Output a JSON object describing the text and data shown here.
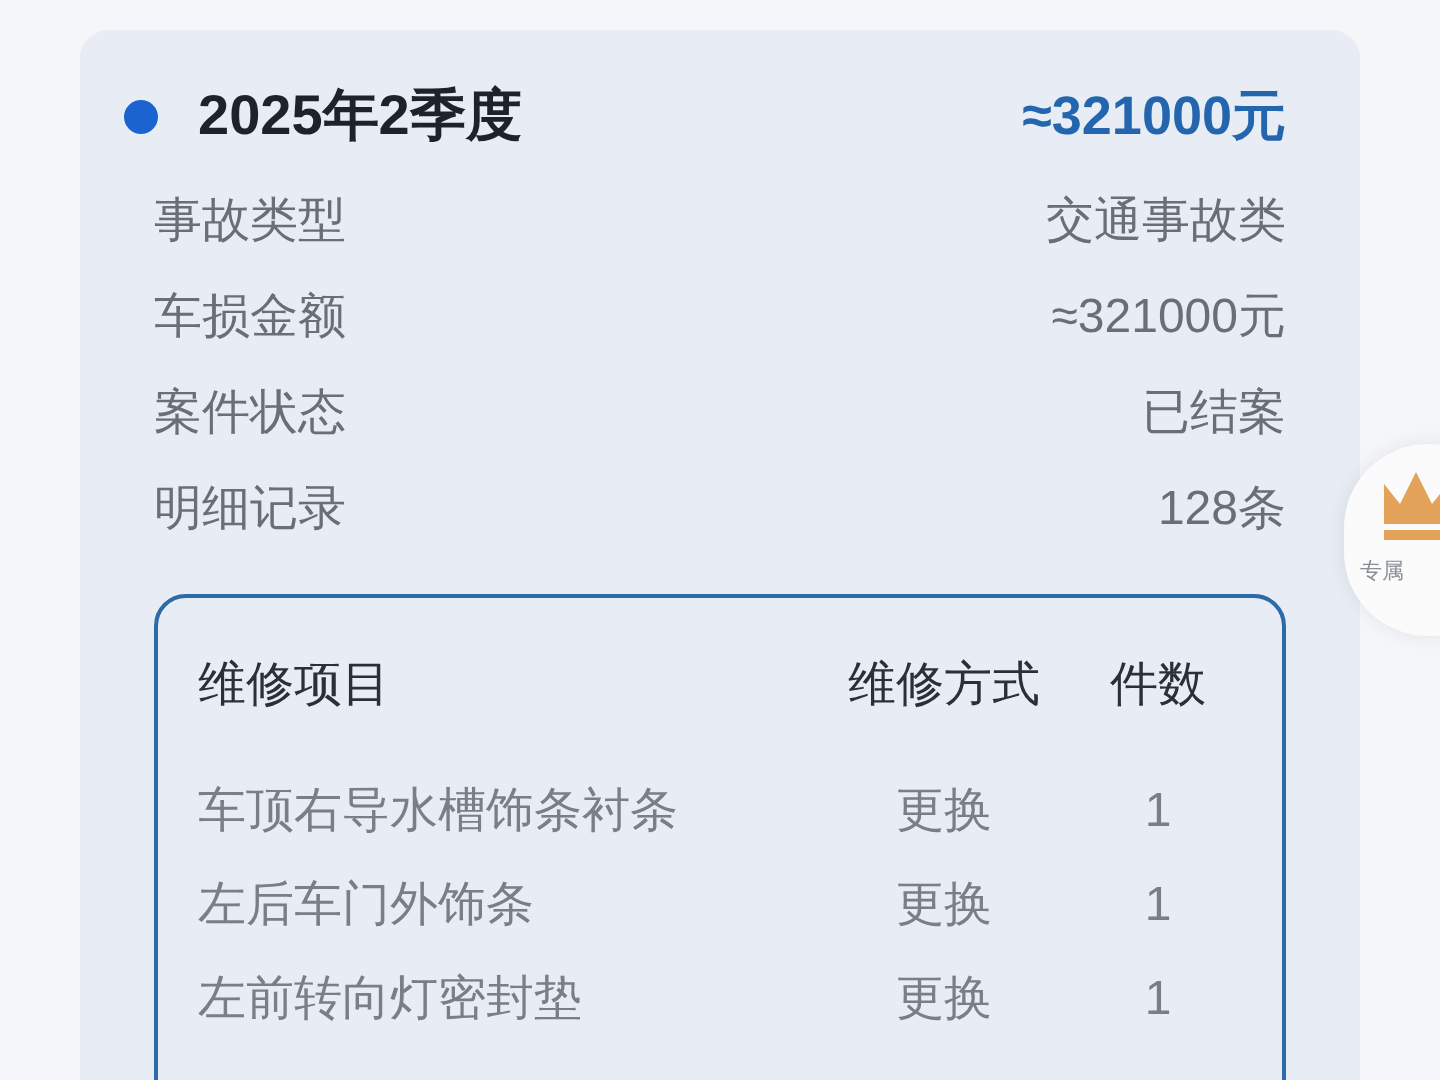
{
  "card": {
    "title": "2025年2季度",
    "amount": "≈321000元",
    "details": [
      {
        "label": "事故类型",
        "value": "交通事故类"
      },
      {
        "label": "车损金额",
        "value": "≈321000元"
      },
      {
        "label": "案件状态",
        "value": "已结案"
      },
      {
        "label": "明细记录",
        "value": "128条"
      }
    ],
    "table": {
      "columns": [
        "维修项目",
        "维修方式",
        "件数"
      ],
      "rows": [
        [
          "车顶右导水槽饰条衬条",
          "更换",
          "1"
        ],
        [
          "左后车门外饰条",
          "更换",
          "1"
        ],
        [
          "左前转向灯密封垫",
          "更换",
          "1"
        ]
      ]
    }
  },
  "floating_badge": {
    "label": "专属"
  }
}
